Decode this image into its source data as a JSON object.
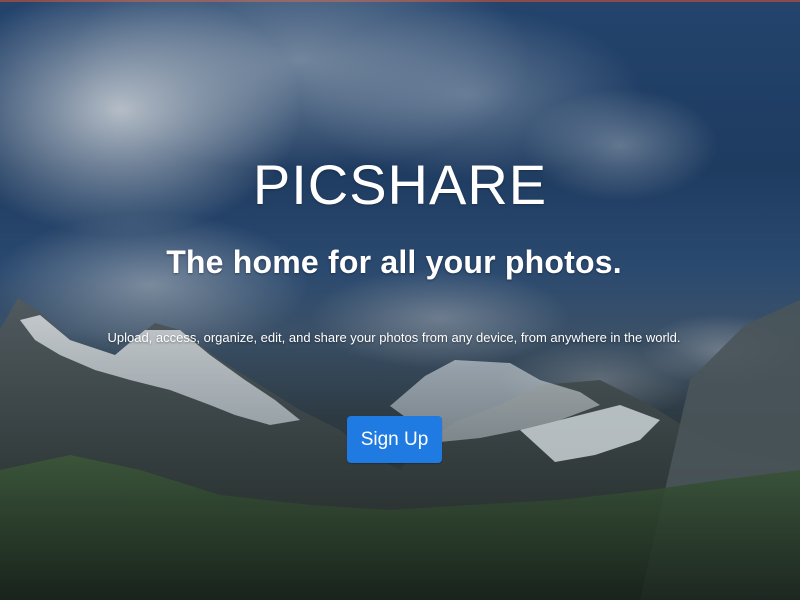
{
  "brand": {
    "title": "PICSHARE"
  },
  "hero": {
    "subtitle": "The home for all your photos.",
    "description": "Upload, access, organize, edit, and share your photos from any device, from anywhere in the world.",
    "cta_label": "Sign Up"
  },
  "colors": {
    "cta": "#1f7be2",
    "text": "#ffffff",
    "sky_top": "#24446d"
  },
  "background": {
    "scene": "mountain-landscape",
    "icon": "landscape-photo"
  }
}
